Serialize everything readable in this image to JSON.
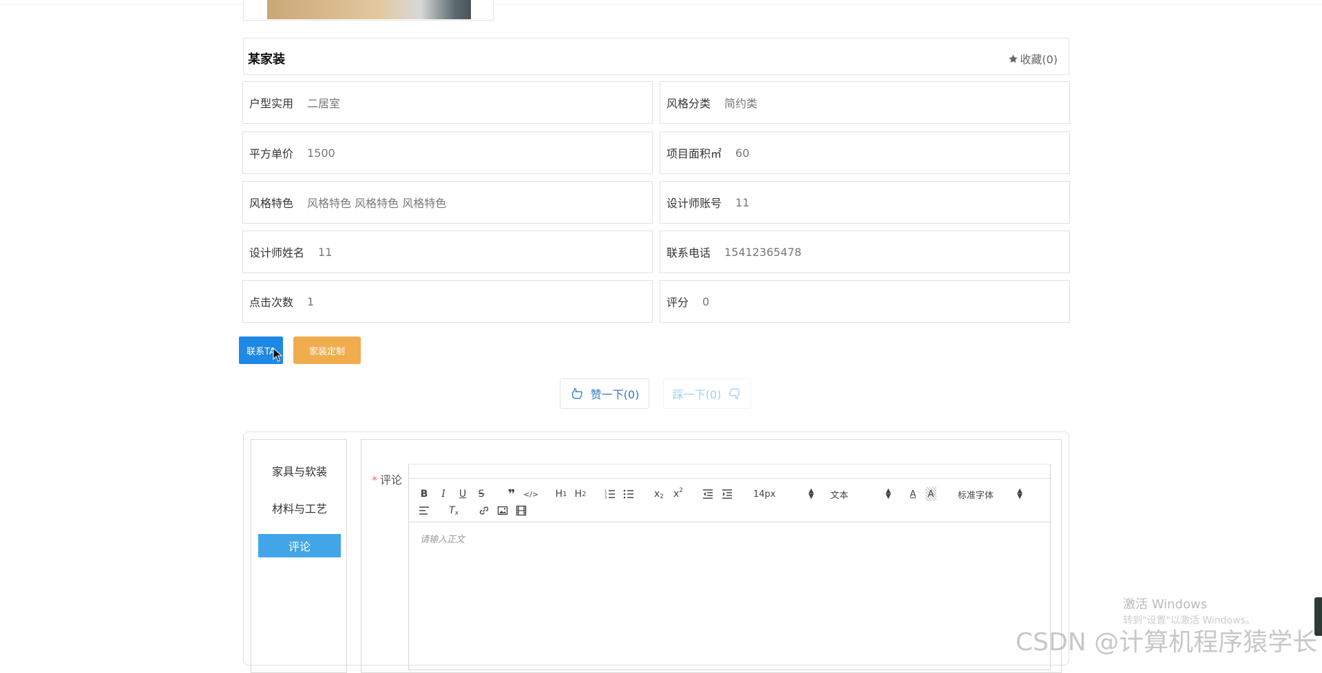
{
  "title": "某家装",
  "favorite": {
    "label": "收藏(0)"
  },
  "details": [
    {
      "label": "户型实用",
      "value": "二居室"
    },
    {
      "label": "风格分类",
      "value": "简约类"
    },
    {
      "label": "平方单价",
      "value": "1500"
    },
    {
      "label": "项目面积㎡",
      "value": "60"
    },
    {
      "label": "风格特色",
      "value": "风格特色 风格特色 风格特色"
    },
    {
      "label": "设计师账号",
      "value": "11"
    },
    {
      "label": "设计师姓名",
      "value": "11"
    },
    {
      "label": "联系电话",
      "value": "15412365478"
    },
    {
      "label": "点击次数",
      "value": "1"
    },
    {
      "label": "评分",
      "value": "0"
    }
  ],
  "buttons": {
    "contact": "联系TA",
    "custom": "家装定制"
  },
  "votes": {
    "up": "赞一下(0)",
    "down": "踩一下(0)"
  },
  "tabs": [
    {
      "label": "家具与软装",
      "active": false
    },
    {
      "label": "材料与工艺",
      "active": false
    },
    {
      "label": "评论",
      "active": true
    }
  ],
  "comment_form": {
    "required_mark": "*",
    "label": "评论",
    "toolbar": {
      "font_size": "14px",
      "heading_select": "文本",
      "font_family": "标准字体"
    },
    "placeholder": "请输入正文"
  },
  "watermarks": {
    "windows_line1": "激活 Windows",
    "windows_line2": "转到\"设置\"以激活 Windows。",
    "csdn": "CSDN @计算机程序猿学长"
  },
  "colors": {
    "primary": "#1e88e5",
    "warning": "#f0ad4e",
    "tab_active": "#42a5e8",
    "required": "#f56c6c"
  }
}
